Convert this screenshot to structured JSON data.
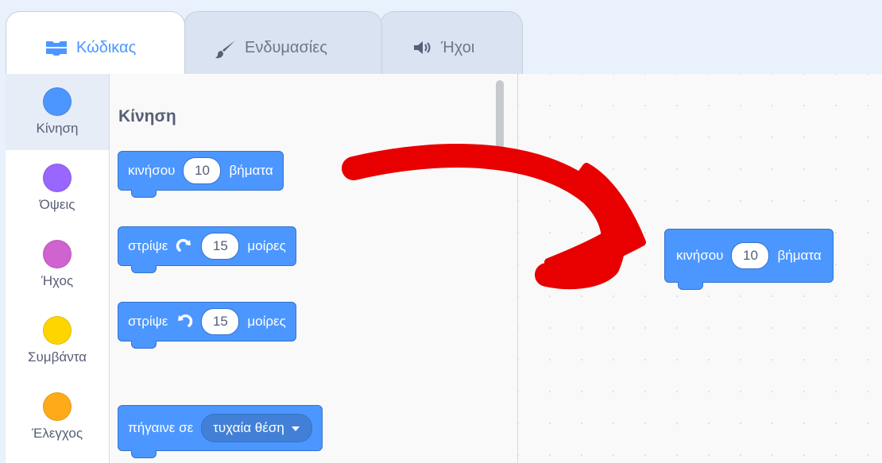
{
  "tabs": {
    "code": "Κώδικας",
    "costumes": "Ενδυμασίες",
    "sounds": "Ήχοι"
  },
  "categories": [
    {
      "label": "Κίνηση",
      "color": "#4c97ff",
      "selected": true
    },
    {
      "label": "Όψεις",
      "color": "#9966ff"
    },
    {
      "label": "Ήχος",
      "color": "#cf63cf"
    },
    {
      "label": "Συμβάντα",
      "color": "#ffd500"
    },
    {
      "label": "Έλεγχος",
      "color": "#ffab19"
    }
  ],
  "palette": {
    "title": "Κίνηση",
    "blocks": {
      "move": {
        "prefix": "κινήσου",
        "value": "10",
        "suffix": "βήματα"
      },
      "turn_right": {
        "prefix": "στρίψε",
        "icon": "rotate-clockwise-icon",
        "value": "15",
        "suffix": "μοίρες"
      },
      "turn_left": {
        "prefix": "στρίψε",
        "icon": "rotate-counterclockwise-icon",
        "value": "15",
        "suffix": "μοίρες"
      },
      "goto": {
        "prefix": "πήγαινε σε",
        "option": "τυχαία θέση"
      }
    }
  },
  "workspace": {
    "block": {
      "prefix": "κινήσου",
      "value": "10",
      "suffix": "βήματα"
    }
  },
  "colors": {
    "motion": "#4c97ff",
    "arrow": "#e80000"
  }
}
